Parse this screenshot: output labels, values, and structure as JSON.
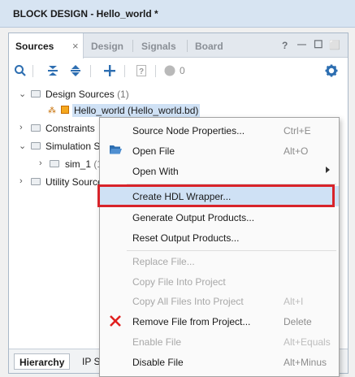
{
  "titlebar": {
    "title": "BLOCK DESIGN - Hello_world *"
  },
  "tabs": [
    {
      "label": "Sources",
      "close": "×"
    },
    {
      "label": "Design"
    },
    {
      "label": "Signals"
    },
    {
      "label": "Board"
    }
  ],
  "window_buttons": {
    "help": "?",
    "minimize": "—",
    "restore": "☐",
    "maximize": "⬜"
  },
  "toolbar": {
    "warning_count": "0"
  },
  "tree": {
    "design_sources": {
      "label": "Design Sources",
      "count": "(1)"
    },
    "hello_world": {
      "label": "Hello_world (Hello_world.bd)"
    },
    "constraints": {
      "label": "Constraints"
    },
    "simulation_sources": {
      "label": "Simulation S"
    },
    "sim_1": {
      "label": "sim_1",
      "suffix": "(1"
    },
    "utility_sources": {
      "label": "Utility Source"
    }
  },
  "bottom_tabs": [
    {
      "label": "Hierarchy"
    },
    {
      "label": "IP S"
    }
  ],
  "context_menu": {
    "items": [
      {
        "label": "Source Node Properties...",
        "shortcut": "Ctrl+E"
      },
      {
        "label": "Open File",
        "shortcut": "Alt+O"
      },
      {
        "label": "Open With",
        "shortcut": ""
      },
      {
        "label": "Create HDL Wrapper...",
        "shortcut": ""
      },
      {
        "label": "Generate Output Products...",
        "shortcut": ""
      },
      {
        "label": "Reset Output Products...",
        "shortcut": ""
      },
      {
        "label": "Replace File...",
        "shortcut": ""
      },
      {
        "label": "Copy File Into Project",
        "shortcut": ""
      },
      {
        "label": "Copy All Files Into Project",
        "shortcut": "Alt+I"
      },
      {
        "label": "Remove File from Project...",
        "shortcut": "Delete"
      },
      {
        "label": "Enable File",
        "shortcut": "Alt+Equals"
      },
      {
        "label": "Disable File",
        "shortcut": "Alt+Minus"
      }
    ]
  },
  "colors": {
    "highlight_box": "#d8232a",
    "selection": "#cfe1f5",
    "accent": "#2d6eb1"
  }
}
